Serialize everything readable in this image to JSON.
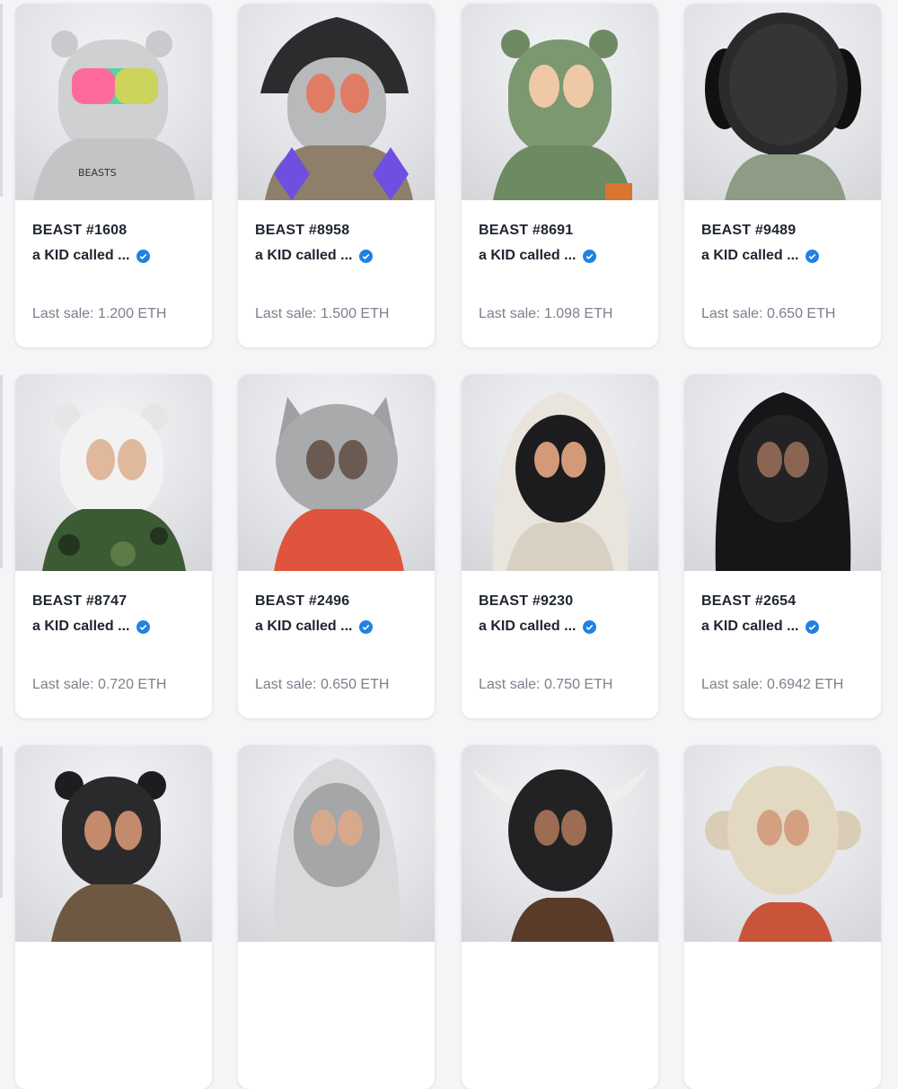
{
  "cards": [
    {
      "title": "BEAST #1608",
      "collection": "a KID called ...",
      "sale_label": "Last sale:",
      "sale_value": "1.200 ETH",
      "art": "gray-bear-rainbow-goggles"
    },
    {
      "title": "BEAST #8958",
      "collection": "a KID called ...",
      "sale_label": "Last sale:",
      "sale_value": "1.500 ETH",
      "art": "bucket-hat-eth-diamonds"
    },
    {
      "title": "BEAST #8691",
      "collection": "a KID called ...",
      "sale_label": "Last sale:",
      "sale_value": "1.098 ETH",
      "art": "green-bear"
    },
    {
      "title": "BEAST #9489",
      "collection": "a KID called ...",
      "sale_label": "Last sale:",
      "sale_value": "0.650 ETH",
      "art": "black-beaded-dog"
    },
    {
      "title": "BEAST #8747",
      "collection": "a KID called ...",
      "sale_label": "Last sale:",
      "sale_value": "0.720 ETH",
      "art": "white-bear-camo"
    },
    {
      "title": "BEAST #2496",
      "collection": "a KID called ...",
      "sale_label": "Last sale:",
      "sale_value": "0.650 ETH",
      "art": "gray-cat-red-hoodie"
    },
    {
      "title": "BEAST #9230",
      "collection": "a KID called ...",
      "sale_label": "Last sale:",
      "sale_value": "0.750 ETH",
      "art": "white-hood-black-mask"
    },
    {
      "title": "BEAST #2654",
      "collection": "a KID called ...",
      "sale_label": "Last sale:",
      "sale_value": "0.6942 ETH",
      "art": "black-hood"
    },
    {
      "title": "",
      "collection": "",
      "sale_label": "",
      "sale_value": "",
      "art": "black-bear"
    },
    {
      "title": "",
      "collection": "",
      "sale_label": "",
      "sale_value": "",
      "art": "gray-hood"
    },
    {
      "title": "",
      "collection": "",
      "sale_label": "",
      "sale_value": "",
      "art": "horned-black"
    },
    {
      "title": "",
      "collection": "",
      "sale_label": "",
      "sale_value": "",
      "art": "beige-monkey"
    }
  ],
  "colors": {
    "verified_badge": "#2081e2",
    "title_text": "#1f2530",
    "muted_text": "#7b818c",
    "page_background": "#f4f5f7"
  },
  "icons": {
    "verified": "verified-badge-icon"
  }
}
